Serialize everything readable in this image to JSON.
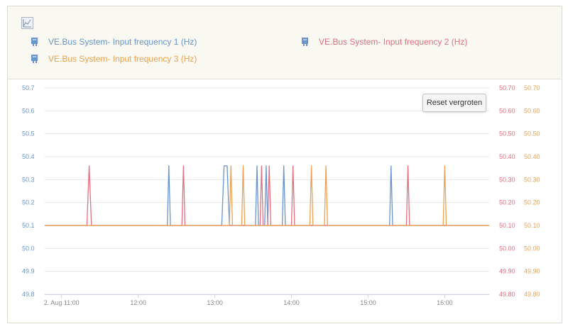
{
  "legend": {
    "items": [
      {
        "label": "VE.Bus System- Input frequency 1 (Hz)",
        "color": "#6a95cc",
        "icon": "battery-marker-icon"
      },
      {
        "label": "VE.Bus System- Input frequency 2 (Hz)",
        "color": "#e07083",
        "icon": "battery-marker-icon"
      },
      {
        "label": "VE.Bus System- Input frequency 3 (Hz)",
        "color": "#eba254",
        "icon": "battery-marker-icon"
      }
    ],
    "toggle_icon": "line-chart-icon"
  },
  "reset_button": {
    "label": "Reset vergroten"
  },
  "chart_data": {
    "type": "line",
    "x_ticks": [
      "2. Aug 11:00",
      "12:00",
      "13:00",
      "14:00",
      "15:00",
      "16:00"
    ],
    "x_tick_hours": [
      11.0,
      12.0,
      13.0,
      14.0,
      15.0,
      16.0
    ],
    "xlim": [
      10.78,
      16.58
    ],
    "ylim": [
      49.8,
      50.7
    ],
    "y_left_ticks": [
      "49.8",
      "49.9",
      "50.0",
      "50.1",
      "50.2",
      "50.3",
      "50.4",
      "50.5",
      "50.6",
      "50.7"
    ],
    "y_right_ticks": [
      "49.80",
      "49.90",
      "50.00",
      "50.10",
      "50.20",
      "50.30",
      "50.40",
      "50.50",
      "50.60",
      "50.70"
    ],
    "grid": true,
    "baseline": 50.1,
    "series": [
      {
        "name": "VE.Bus System- Input frequency 1 (Hz)",
        "color": "#6a95cc",
        "points": [
          [
            10.78,
            50.1
          ],
          [
            12.38,
            50.1
          ],
          [
            12.4,
            50.36
          ],
          [
            12.42,
            50.1
          ],
          [
            13.09,
            50.1
          ],
          [
            13.12,
            50.36
          ],
          [
            13.16,
            50.36
          ],
          [
            13.19,
            50.1
          ],
          [
            13.53,
            50.1
          ],
          [
            13.55,
            50.36
          ],
          [
            13.57,
            50.1
          ],
          [
            13.65,
            50.1
          ],
          [
            13.67,
            50.36
          ],
          [
            13.69,
            50.1
          ],
          [
            13.88,
            50.1
          ],
          [
            13.9,
            50.36
          ],
          [
            13.92,
            50.1
          ],
          [
            15.28,
            50.1
          ],
          [
            15.3,
            50.36
          ],
          [
            15.32,
            50.1
          ],
          [
            16.58,
            50.1
          ]
        ]
      },
      {
        "name": "VE.Bus System- Input frequency 2 (Hz)",
        "color": "#e07083",
        "points": [
          [
            10.78,
            50.1
          ],
          [
            11.33,
            50.1
          ],
          [
            11.36,
            50.36
          ],
          [
            11.39,
            50.1
          ],
          [
            12.57,
            50.1
          ],
          [
            12.59,
            50.36
          ],
          [
            12.61,
            50.1
          ],
          [
            13.59,
            50.1
          ],
          [
            13.61,
            50.36
          ],
          [
            13.63,
            50.1
          ],
          [
            13.69,
            50.1
          ],
          [
            13.71,
            50.36
          ],
          [
            13.73,
            50.1
          ],
          [
            14.0,
            50.1
          ],
          [
            14.02,
            50.36
          ],
          [
            14.04,
            50.1
          ],
          [
            15.5,
            50.1
          ],
          [
            15.52,
            50.36
          ],
          [
            15.54,
            50.1
          ],
          [
            16.58,
            50.1
          ]
        ]
      },
      {
        "name": "VE.Bus System- Input frequency 3 (Hz)",
        "color": "#eba254",
        "points": [
          [
            10.78,
            50.1
          ],
          [
            13.19,
            50.1
          ],
          [
            13.21,
            50.36
          ],
          [
            13.23,
            50.1
          ],
          [
            13.35,
            50.1
          ],
          [
            13.37,
            50.36
          ],
          [
            13.39,
            50.1
          ],
          [
            14.24,
            50.1
          ],
          [
            14.26,
            50.36
          ],
          [
            14.28,
            50.1
          ],
          [
            14.43,
            50.1
          ],
          [
            14.45,
            50.36
          ],
          [
            14.47,
            50.1
          ],
          [
            15.98,
            50.1
          ],
          [
            16.0,
            50.36
          ],
          [
            16.02,
            50.1
          ],
          [
            16.58,
            50.1
          ]
        ]
      }
    ]
  }
}
